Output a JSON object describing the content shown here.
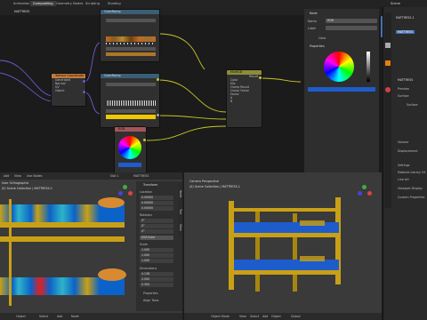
{
  "topbar": {
    "tabs": [
      "Animation",
      "Compositing",
      "Geometry Nodes",
      "Scripting"
    ],
    "tab2": "Shading",
    "scene_label": "Scene",
    "viewlayer_label": "ViewLayer"
  },
  "node_editor": {
    "breadcrumb": "MATTRESS",
    "nodes": {
      "texcoord": {
        "title": "Texture Coordinate",
        "rows": [
          "Generated",
          "Normal",
          "UV",
          "Object",
          "Camera",
          "Window",
          "Reflection"
        ]
      },
      "ramp_top": {
        "title": "ColorRamp",
        "rows": [
          "RGB",
          "Linear",
          "Pos",
          "Color",
          "Alpha",
          "Fac"
        ]
      },
      "ramp_mid": {
        "title": "ColorRamp",
        "rows": [
          "Color",
          "Alpha",
          "Fac"
        ]
      },
      "rgb": {
        "title": "RGB",
        "rows": [
          "Color"
        ]
      },
      "mix": {
        "title": "MixRGB",
        "rows": [
          "Result",
          "Color",
          "Mix",
          "Clamp Result",
          "Clamp Factor",
          "Factor",
          "A",
          "B"
        ]
      }
    },
    "side_panel": {
      "title": "Node",
      "name_label": "Name",
      "name_value": "RGB",
      "label_label": "Label",
      "label_value": "",
      "color_section": "Color",
      "properties_section": "Properties"
    },
    "vtabs": [
      "Node",
      "Tool",
      "View",
      "Options"
    ]
  },
  "properties": {
    "header_scene": "Scene",
    "object_name": "MATTRESS-1",
    "material_name": "MATTRESS",
    "items": [
      "Preview",
      "Surface",
      "Surface",
      "Base Color",
      "Subsurface",
      "Volume",
      "Displacement",
      "Settings",
      "Line Art",
      "Viewport Display",
      "Custom Properties"
    ],
    "surface_label": "Surface",
    "settings_label": "Settings",
    "material_line": "Material Library VX"
  },
  "viewport_left": {
    "header": {
      "add": "Add",
      "view": "View",
      "use_nodes": "Use Nodes",
      "slot": "Slot 1",
      "material": "MATTRESS"
    },
    "title": "User Orthographic",
    "collection": "(0) Scene Collection | MATTRESS-1",
    "transform": {
      "title": "Transform",
      "location_label": "Location",
      "loc": [
        "0.00000",
        "0.00000",
        "0.00000"
      ],
      "rotation_label": "Rotation",
      "rot": [
        "0°",
        "0°",
        "0°"
      ],
      "mode": "XYZ Euler",
      "scale_label": "Scale",
      "scale": [
        "1.000",
        "1.000",
        "1.000"
      ],
      "dim_label": "Dimensions",
      "dim": [
        "4.136",
        "2.500",
        "0.300"
      ],
      "props": "Properties",
      "tools": "Align Tools"
    },
    "axes": [
      "X",
      "Y",
      "Z"
    ]
  },
  "viewport_right": {
    "title": "Camera Perspective",
    "collection": "(0) Scene Collection | MATTRESS-1",
    "footer": {
      "mode": "Object Mode",
      "view": "View",
      "select": "Select",
      "add": "Add",
      "object": "Object",
      "global": "Global"
    }
  },
  "footer_left": {
    "items": [
      "Object",
      "Select",
      "Add",
      "Node",
      "Object"
    ]
  },
  "colors": {
    "accent_blue": "#4772b3",
    "active_orange": "#e87d0d",
    "bed_yellow": "#c9a015",
    "mattress_blue": "#1e5ccc"
  }
}
